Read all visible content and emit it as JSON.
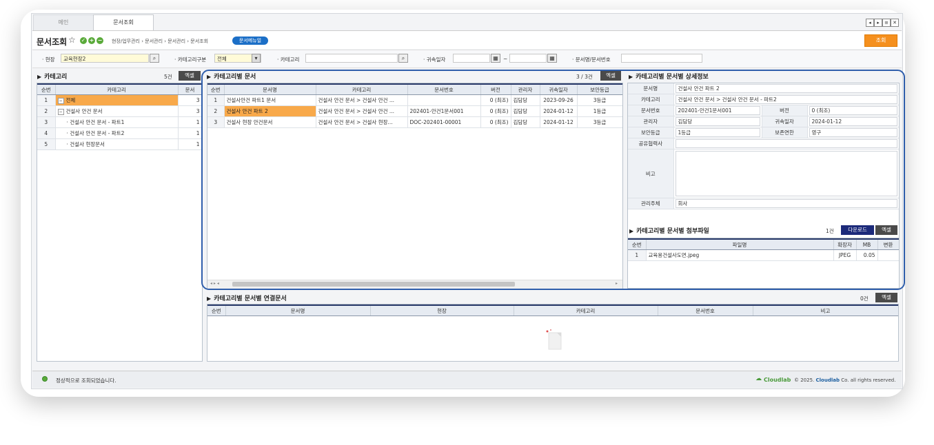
{
  "tabs": [
    {
      "label": "메인",
      "active": false
    },
    {
      "label": "문서조회",
      "active": true
    }
  ],
  "window_controls": [
    "◂",
    "▸",
    "≡",
    "✕"
  ],
  "header": {
    "title": "문서조회",
    "breadcrumb": "현장/업무관리 › 문서관리 › 문서관리 › 문서조회",
    "manual_label": "문서메뉴얼",
    "search_label": "조회"
  },
  "filters": {
    "site_label": "· 현장",
    "site_value": "교육현장2",
    "category_type_label": "· 카테고리구분",
    "category_type_value": "전체",
    "category_label": "· 카테고리",
    "category_value": "",
    "date_label": "· 귀속일자",
    "date_from": "",
    "date_sep": "~",
    "date_to": "",
    "docname_label": "· 문서명/문서번호",
    "docname_value": ""
  },
  "category_panel": {
    "title": "카테고리",
    "count": "5건",
    "excel_label": "엑셀",
    "columns": [
      "순번",
      "카테고리",
      "문서"
    ],
    "rows": [
      {
        "seq": "1",
        "name": "전체",
        "count": "3",
        "toggle": "−",
        "indent": 0,
        "selected": true
      },
      {
        "seq": "2",
        "name": "건설사 안건 문서",
        "count": "3",
        "toggle": "−",
        "indent": 0,
        "selected": false
      },
      {
        "seq": "3",
        "name": "· 건설사 안건 문서 - 파트1",
        "count": "1",
        "toggle": "",
        "indent": 1,
        "selected": false
      },
      {
        "seq": "4",
        "name": "· 건설사 안건 문서 - 파트2",
        "count": "1",
        "toggle": "",
        "indent": 1,
        "selected": false
      },
      {
        "seq": "5",
        "name": "· 건설사 현장문서",
        "count": "1",
        "toggle": "",
        "indent": 1,
        "selected": false
      }
    ]
  },
  "docs_panel": {
    "title": "카테고리별 문서",
    "count": "3 / 3건",
    "excel_label": "엑셀",
    "columns": [
      "순번",
      "문서명",
      "카테고리",
      "문서번호",
      "버전",
      "관리자",
      "귀속일자",
      "보안등급"
    ],
    "rows": [
      {
        "seq": "1",
        "name": "건설사안건 파트1 문서",
        "category": "건설사 안건 문서 > 건설사 안건 ...",
        "docno": "",
        "version": "0 (최조)",
        "manager": "김담당",
        "date": "2023-09-26",
        "security": "3등급",
        "selected": false
      },
      {
        "seq": "2",
        "name": "건설사 안건 파트 2",
        "category": "건설사 안건 문서 > 건설사 안건 ...",
        "docno": "202401-안건1문서001",
        "version": "0 (최조)",
        "manager": "김담당",
        "date": "2024-01-12",
        "security": "1등급",
        "selected": true
      },
      {
        "seq": "3",
        "name": "건설사 현장 안건문서",
        "category": "건설사 안건 문서 > 건설사 현장...",
        "docno": "DOC-202401-00001",
        "version": "0 (최조)",
        "manager": "김담당",
        "date": "2024-01-12",
        "security": "3등급",
        "selected": false
      }
    ]
  },
  "detail_panel": {
    "title": "카테고리별 문서별 상세정보",
    "doc_name_label": "문서명",
    "doc_name": "건설사 안건 파트 2",
    "category_label": "카테고리",
    "category": "건설사 안건 문서 > 건설사 안건 문서 - 파트2",
    "docno_label": "문서번호",
    "docno": "202401-안건1문서001",
    "version_label": "버전",
    "version": "0 (최조)",
    "manager_label": "관리자",
    "manager": "김담당",
    "date_label": "귀속일자",
    "date": "2024-01-12",
    "security_label": "보안등급",
    "security": "1등급",
    "retention_label": "보존연한",
    "retention": "영구",
    "partner_label": "공유협력사",
    "partner": "",
    "note_label": "비고",
    "note": "",
    "owner_label": "관리주체",
    "owner": "회사"
  },
  "attach_panel": {
    "title": "카테고리별 문서별 첨부파일",
    "count": "1건",
    "download_label": "다운로드",
    "excel_label": "엑셀",
    "columns": [
      "순번",
      "파일명",
      "확장자",
      "MB",
      "변환"
    ],
    "rows": [
      {
        "seq": "1",
        "name": "교육용건설사도면.jpeg",
        "ext": "JPEG",
        "mb": "0.05",
        "convert": ""
      }
    ]
  },
  "linked_panel": {
    "title": "카테고리별 문서별 연결문서",
    "count": "0건",
    "excel_label": "엑셀",
    "columns": [
      "순번",
      "문서명",
      "현장",
      "카테고리",
      "문서번호",
      "비고"
    ]
  },
  "status": {
    "message": "정상적으로 조회되었습니다.",
    "brand": "Cloudlab",
    "copyright_prefix": "© 2025.",
    "copyright_brand": "Cloudlab",
    "copyright_suffix": "Co. all rights reserved."
  },
  "colors": {
    "accent_orange": "#f5901e",
    "selection": "#f8a94a",
    "navy": "#1c2a7a",
    "brand_green": "#4a9a3a",
    "highlight_frame": "#2f5eab"
  }
}
